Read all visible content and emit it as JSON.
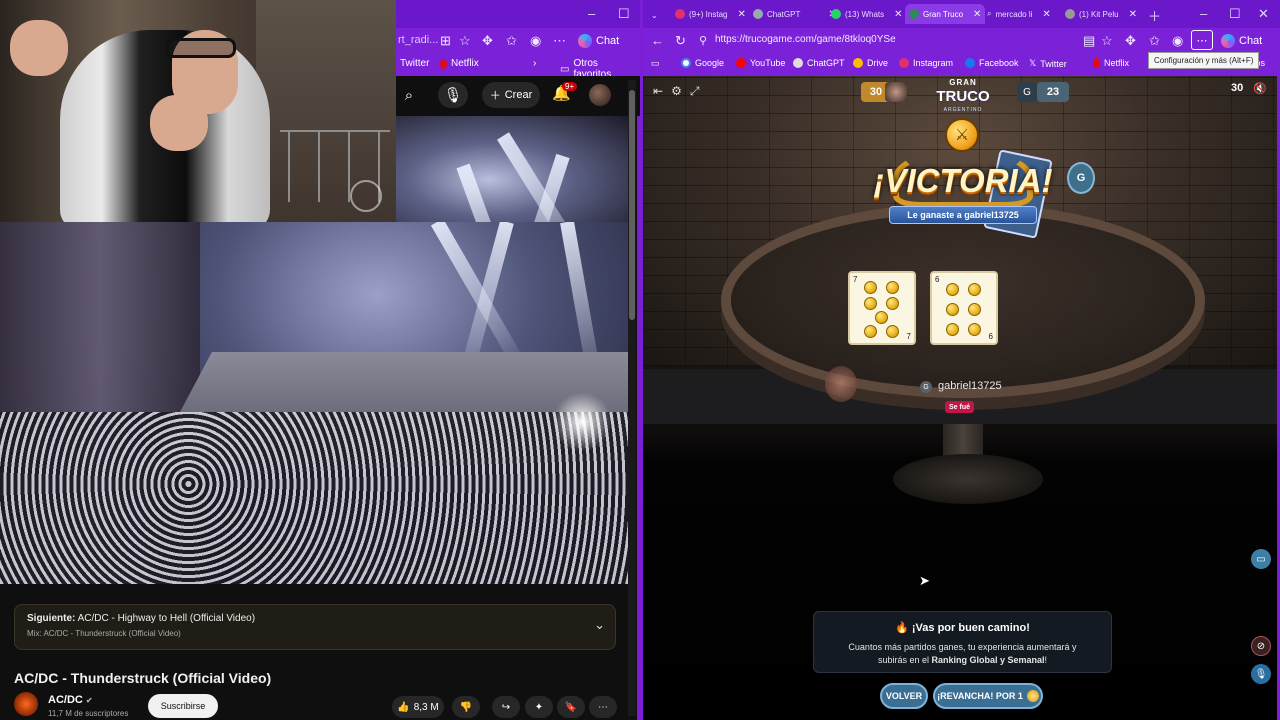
{
  "left_browser": {
    "address_fragment": "rt_radi...",
    "chat_label": "Chat",
    "bookmarks": [
      {
        "label": "Twitter"
      },
      {
        "label": "Netflix"
      },
      {
        "label": "Otros favoritos"
      }
    ]
  },
  "youtube": {
    "create_label": "Crear",
    "notification_count": "9+",
    "up_next": {
      "prefix": "Siguiente:",
      "title": "AC/DC - Highway to Hell (Official Video)",
      "mix": "Mix: AC/DC - Thunderstruck (Official Video)"
    },
    "video_title": "AC/DC - Thunderstruck (Official Video)",
    "channel_name": "AC/DC",
    "subscribers": "11,7 M de suscriptores",
    "subscribe_label": "Suscribirse",
    "likes": "8,3 M"
  },
  "right_browser": {
    "tabs": [
      {
        "label": "(9+) Instag"
      },
      {
        "label": "ChatGPT"
      },
      {
        "label": "(13) Whats"
      },
      {
        "label": "Gran Truco"
      },
      {
        "label": "mercado li"
      },
      {
        "label": "(1) Kit Pelu"
      }
    ],
    "url": "https://trucogame.com/game/8tkloq0YSe",
    "chat_label": "Chat",
    "tooltip": "Configuración y más (Alt+F)",
    "bookmarks": [
      {
        "label": "Google"
      },
      {
        "label": "YouTube"
      },
      {
        "label": "ChatGPT"
      },
      {
        "label": "Drive"
      },
      {
        "label": "Instagram"
      },
      {
        "label": "Facebook"
      },
      {
        "label": "Twitter"
      },
      {
        "label": "Netflix"
      },
      {
        "label": "tos"
      }
    ]
  },
  "game": {
    "score_left": "30",
    "score_right": "23",
    "opponent_initial": "G",
    "logo_line1": "GRAN",
    "logo_line2": "TRUCO",
    "logo_line3": "ARGENTINO",
    "timer": "30",
    "victory_title": "¡VICTORIA!",
    "victory_subtitle": "Le ganaste a gabriel13725",
    "player_marker": "G",
    "player_name": "gabriel13725",
    "player_status": "Se fué",
    "cards": [
      {
        "rank": "7",
        "suit": "oro"
      },
      {
        "rank": "6",
        "suit": "oro"
      }
    ],
    "toast_title": "¡Vas por buen camino!",
    "toast_line1": "Cuantos más partidos ganes, tu experiencia aumentará y",
    "toast_line2_prefix": "subirás en el",
    "toast_line2_bold": "Ranking Global y Semanal",
    "toast_line2_suffix": "!",
    "button_volver": "VOLVER",
    "button_revancha": "¡REVANCHA! POR 1"
  }
}
